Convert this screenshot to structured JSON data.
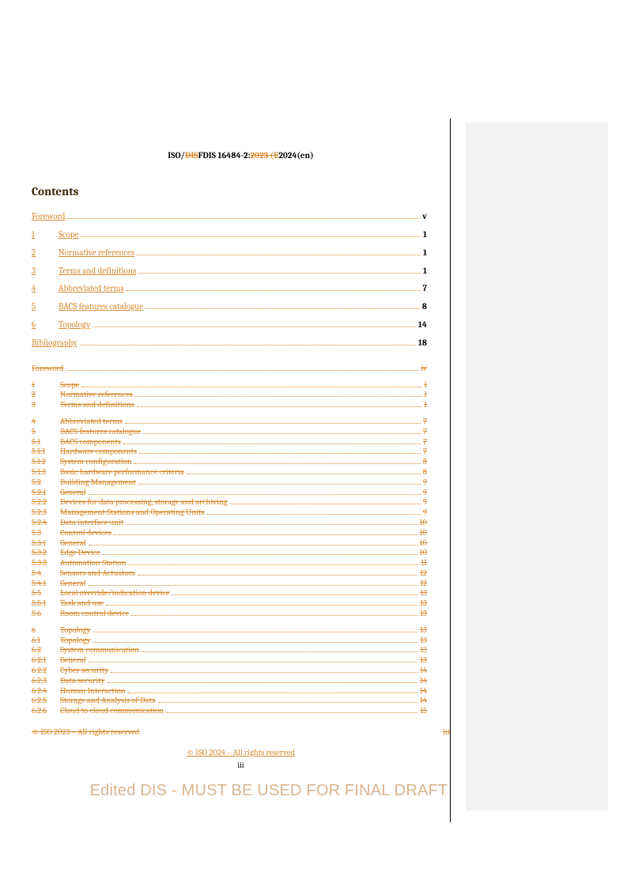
{
  "header": {
    "prefix": "ISO/",
    "dis_struck": "DIS",
    "fdis": "FDIS",
    "mid": " 16484-2:",
    "y2023_struck": "2023 (E",
    "y2024": "2024(en",
    "suffix": ")"
  },
  "contents_title": "Contents",
  "toc_new": [
    {
      "num": "",
      "label": "Foreword",
      "page": "v"
    },
    {
      "num": "1",
      "label": "Scope",
      "page": "1"
    },
    {
      "num": "2",
      "label": "Normative references",
      "page": "1"
    },
    {
      "num": "3",
      "label": "Terms and definitions",
      "page": "1"
    },
    {
      "num": "4",
      "label": "Abbreviated terms",
      "page": "7"
    },
    {
      "num": "5",
      "label": "BACS features catalogue",
      "page": "8"
    },
    {
      "num": "6",
      "label": "Topology",
      "page": "14"
    },
    {
      "num": "",
      "label": "Bibliography",
      "page": "18"
    }
  ],
  "toc_old": [
    {
      "num": "",
      "label": "Foreword",
      "page": "iv",
      "gap": true
    },
    {
      "num": "1",
      "label": "Scope",
      "page": "1"
    },
    {
      "num": "2",
      "label": "Normative references",
      "page": "1"
    },
    {
      "num": "3",
      "label": "Terms and definitions",
      "page": "1",
      "gap": true
    },
    {
      "num": "4",
      "label": "Abbreviated terms",
      "page": "7"
    },
    {
      "num": "5",
      "label": "BACS features catalogue",
      "page": "7"
    },
    {
      "num": "5.1",
      "label": "BACS components",
      "page": "7"
    },
    {
      "num": "5.1.1",
      "label": "Hardware components",
      "page": "7"
    },
    {
      "num": "5.1.2",
      "label": "System configuration",
      "page": "8"
    },
    {
      "num": "5.1.3",
      "label": "Basic hardware performance criteria",
      "page": "8"
    },
    {
      "num": "5.2",
      "label": "Building Management",
      "page": "9"
    },
    {
      "num": "5.2.1",
      "label": "General",
      "page": "9"
    },
    {
      "num": "5.2.2",
      "label": "Devices for data processing, storage and archiving",
      "page": "9"
    },
    {
      "num": "5.2.3",
      "label": "Management Stations and Operating Units",
      "page": "9"
    },
    {
      "num": "5.2.4",
      "label": "Data interface unit",
      "page": "10"
    },
    {
      "num": "5.3",
      "label": "Control devices",
      "page": "10"
    },
    {
      "num": "5.3.1",
      "label": "General",
      "page": "10"
    },
    {
      "num": "5.3.2",
      "label": "Edge Device",
      "page": "10"
    },
    {
      "num": "5.3.3",
      "label": "Automation Station",
      "page": "11"
    },
    {
      "num": "5.4",
      "label": "Sensors and Actuators",
      "page": "12"
    },
    {
      "num": "5.4.1",
      "label": "General",
      "page": "12"
    },
    {
      "num": "5.5",
      "label": "Local override/indication device",
      "page": "13"
    },
    {
      "num": "5.5.1",
      "label": "Task and use",
      "page": "13"
    },
    {
      "num": "5.6",
      "label": "Room control device",
      "page": "13",
      "gap": true
    },
    {
      "num": "6",
      "label": "Topology",
      "page": "13"
    },
    {
      "num": "6.1",
      "label": "Topology",
      "page": "13"
    },
    {
      "num": "6.2",
      "label": "System communication",
      "page": "13"
    },
    {
      "num": "6.2.1",
      "label": "General",
      "page": "13"
    },
    {
      "num": "6.2.2",
      "label": "Cyber security",
      "page": "14"
    },
    {
      "num": "6.2.3",
      "label": "Data security",
      "page": "14"
    },
    {
      "num": "6.2.4",
      "label": "Human Interaction",
      "page": "14"
    },
    {
      "num": "6.2.5",
      "label": "Storage and Analysis of Data",
      "page": "14"
    },
    {
      "num": "6.2.6",
      "label": "Cloud to cloud communication",
      "page": "15"
    }
  ],
  "old_copy": {
    "left": "© ISO 2023 – All rights reserved",
    "right": "iii"
  },
  "new_copy": "© ISO 2024 – All rights reserved",
  "pagenum": "iii",
  "watermark": "Edited DIS - MUST BE USED FOR FINAL DRAFT"
}
